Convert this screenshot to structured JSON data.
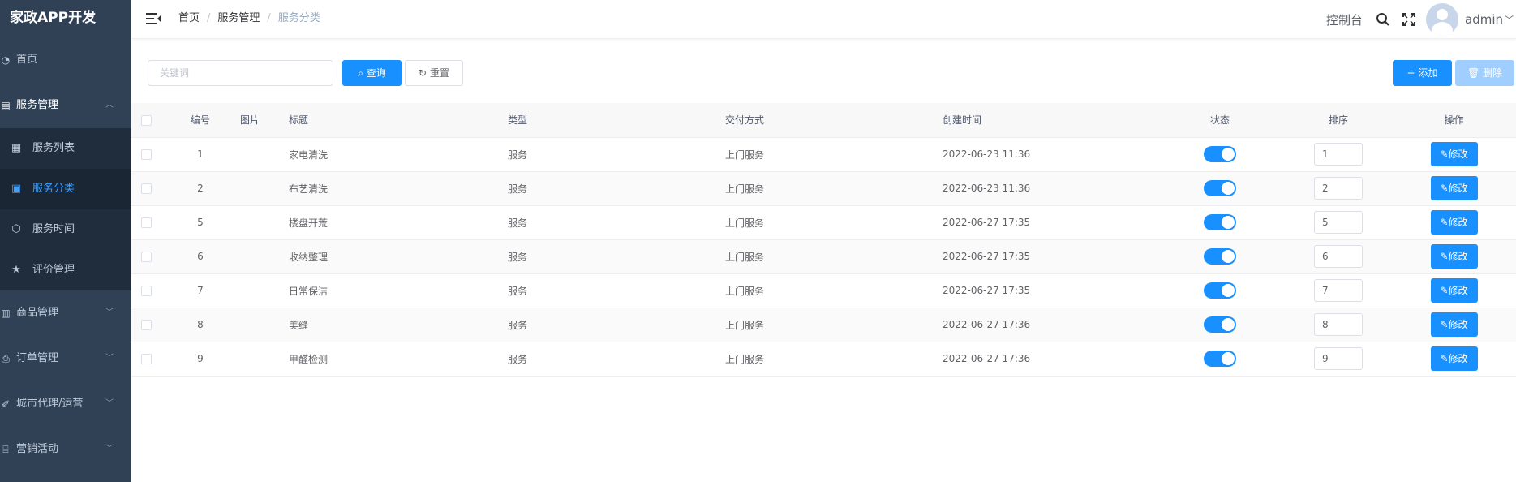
{
  "sidebar": {
    "brand": "家政APP开发",
    "items": [
      {
        "label": "首页",
        "icon": "dashboard-icon"
      },
      {
        "label": "服务管理",
        "icon": "service-icon",
        "open": true,
        "children": [
          {
            "label": "服务列表",
            "icon": "clipboard-icon"
          },
          {
            "label": "服务分类",
            "icon": "category-icon",
            "active": true
          },
          {
            "label": "服务时间",
            "icon": "clock-tag-icon"
          },
          {
            "label": "评价管理",
            "icon": "star-icon"
          }
        ]
      },
      {
        "label": "商品管理",
        "icon": "goods-icon"
      },
      {
        "label": "订单管理",
        "icon": "order-icon"
      },
      {
        "label": "城市代理/运营",
        "icon": "city-icon"
      },
      {
        "label": "营销活动",
        "icon": "marketing-icon"
      }
    ]
  },
  "navbar": {
    "breadcrumb": [
      "首页",
      "服务管理",
      "服务分类"
    ],
    "console": "控制台",
    "username": "admin"
  },
  "toolbar": {
    "keyword_placeholder": "关键词",
    "search_label": "查询",
    "reset_label": "重置",
    "add_label": "添加",
    "delete_label": "删除"
  },
  "table": {
    "columns": [
      "编号",
      "图片",
      "标题",
      "类型",
      "交付方式",
      "创建时间",
      "状态",
      "排序",
      "操作"
    ],
    "edit_label": "修改",
    "rows": [
      {
        "id": "1",
        "title": "家电清洗",
        "type": "服务",
        "delivery": "上门服务",
        "created": "2022-06-23 11:36",
        "status": true,
        "sort": "1"
      },
      {
        "id": "2",
        "title": "布艺清洗",
        "type": "服务",
        "delivery": "上门服务",
        "created": "2022-06-23 11:36",
        "status": true,
        "sort": "2"
      },
      {
        "id": "5",
        "title": "楼盘开荒",
        "type": "服务",
        "delivery": "上门服务",
        "created": "2022-06-27 17:35",
        "status": true,
        "sort": "5"
      },
      {
        "id": "6",
        "title": "收纳整理",
        "type": "服务",
        "delivery": "上门服务",
        "created": "2022-06-27 17:35",
        "status": true,
        "sort": "6"
      },
      {
        "id": "7",
        "title": "日常保洁",
        "type": "服务",
        "delivery": "上门服务",
        "created": "2022-06-27 17:35",
        "status": true,
        "sort": "7"
      },
      {
        "id": "8",
        "title": "美缝",
        "type": "服务",
        "delivery": "上门服务",
        "created": "2022-06-27 17:36",
        "status": true,
        "sort": "8"
      },
      {
        "id": "9",
        "title": "甲醛检测",
        "type": "服务",
        "delivery": "上门服务",
        "created": "2022-06-27 17:36",
        "status": true,
        "sort": "9"
      }
    ]
  },
  "colors": {
    "primary": "#1890ff",
    "sidebar_bg": "#304156",
    "submenu_bg": "#1f2d3d",
    "active_text": "#409eff"
  }
}
